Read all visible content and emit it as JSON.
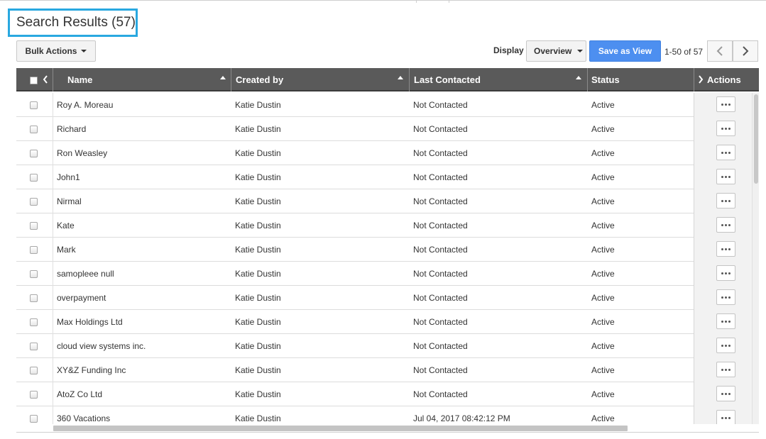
{
  "title": "Search Results (57)",
  "toolbar": {
    "bulk_actions_label": "Bulk Actions",
    "display_label": "Display",
    "display_value": "Overview",
    "save_view_label": "Save as View",
    "pager_text": "1-50 of 57"
  },
  "columns": {
    "name": "Name",
    "created_by": "Created by",
    "last_contacted": "Last Contacted",
    "status": "Status",
    "actions": "Actions"
  },
  "rows": [
    {
      "name": "Roy A. Moreau",
      "created_by": "Katie Dustin",
      "last_contacted": "Not Contacted",
      "status": "Active"
    },
    {
      "name": "Richard",
      "created_by": "Katie Dustin",
      "last_contacted": "Not Contacted",
      "status": "Active"
    },
    {
      "name": "Ron Weasley",
      "created_by": "Katie Dustin",
      "last_contacted": "Not Contacted",
      "status": "Active"
    },
    {
      "name": "John1",
      "created_by": "Katie Dustin",
      "last_contacted": "Not Contacted",
      "status": "Active"
    },
    {
      "name": "Nirmal",
      "created_by": "Katie Dustin",
      "last_contacted": "Not Contacted",
      "status": "Active"
    },
    {
      "name": "Kate",
      "created_by": "Katie Dustin",
      "last_contacted": "Not Contacted",
      "status": "Active"
    },
    {
      "name": "Mark",
      "created_by": "Katie Dustin",
      "last_contacted": "Not Contacted",
      "status": "Active"
    },
    {
      "name": "samopleee null",
      "created_by": "Katie Dustin",
      "last_contacted": "Not Contacted",
      "status": "Active"
    },
    {
      "name": "overpayment",
      "created_by": "Katie Dustin",
      "last_contacted": "Not Contacted",
      "status": "Active"
    },
    {
      "name": "Max Holdings Ltd",
      "created_by": "Katie Dustin",
      "last_contacted": "Not Contacted",
      "status": "Active"
    },
    {
      "name": "cloud view systems inc.",
      "created_by": "Katie Dustin",
      "last_contacted": "Not Contacted",
      "status": "Active"
    },
    {
      "name": "XY&Z Funding Inc",
      "created_by": "Katie Dustin",
      "last_contacted": "Not Contacted",
      "status": "Active"
    },
    {
      "name": "AtoZ Co Ltd",
      "created_by": "Katie Dustin",
      "last_contacted": "Not Contacted",
      "status": "Active"
    },
    {
      "name": "360 Vacations",
      "created_by": "Katie Dustin",
      "last_contacted": "Jul 04, 2017 08:42:12 PM",
      "status": "Active"
    }
  ],
  "icons": {
    "sort": "sort-ascending-icon",
    "prev": "chevron-left-icon",
    "next": "chevron-right-icon",
    "more": "more-dots-icon",
    "dropdown": "caret-down-icon"
  },
  "colors": {
    "title_border": "#29a8e0",
    "primary_button": "#4d8ff0",
    "header_bg": "#5a5a5a"
  }
}
